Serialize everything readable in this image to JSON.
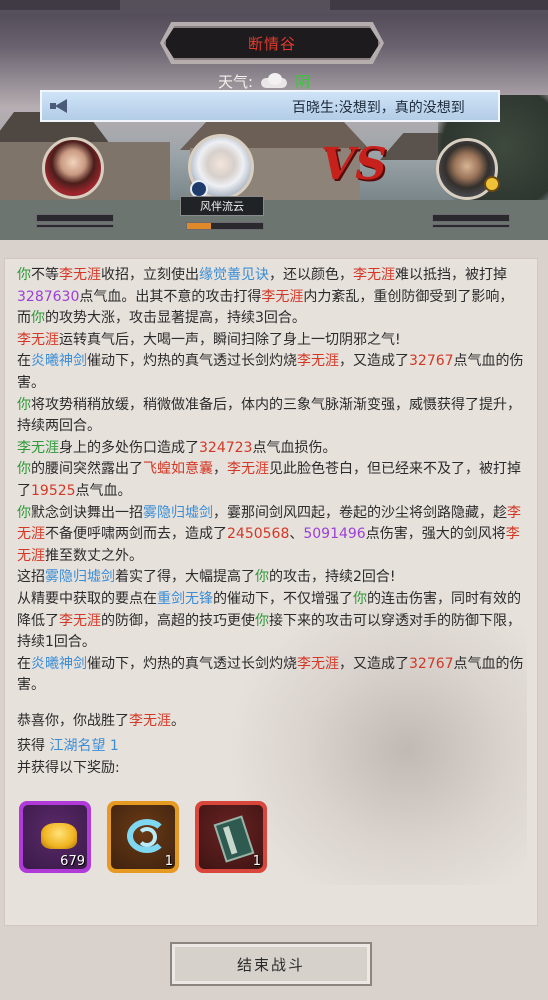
{
  "header": {
    "location": "断情谷",
    "weather_label": "天气:",
    "weather_value": "阴"
  },
  "broadcast": {
    "text": "百晓生:没想到，真的没想到"
  },
  "fighters": {
    "middle_name": "风伴流云"
  },
  "vs_text": "VS",
  "log": [
    [
      {
        "t": "你",
        "c": "g"
      },
      {
        "t": "不等"
      },
      {
        "t": "李无涯",
        "c": "r"
      },
      {
        "t": "收招，立刻使出"
      },
      {
        "t": "缘觉善见诀",
        "c": "b"
      },
      {
        "t": "，还以颜色，"
      },
      {
        "t": "李无涯",
        "c": "r"
      },
      {
        "t": "难以抵挡，被打掉"
      },
      {
        "t": "3287630",
        "c": "pu"
      },
      {
        "t": "点气血。出其不意的攻击打得"
      },
      {
        "t": "李无涯",
        "c": "r"
      },
      {
        "t": "内力紊乱，重创防御受到了影响，而"
      },
      {
        "t": "你",
        "c": "g"
      },
      {
        "t": "的攻势大涨，攻击显著提高，持续3回合。"
      }
    ],
    [
      {
        "t": "李无涯",
        "c": "r"
      },
      {
        "t": "运转真气后，大喝一声，瞬间扫除了身上一切阴邪之气!"
      }
    ],
    [
      {
        "t": "在"
      },
      {
        "t": "炎曦神剑",
        "c": "b"
      },
      {
        "t": "催动下，灼热的真气透过长剑灼烧"
      },
      {
        "t": "李无涯",
        "c": "r"
      },
      {
        "t": "，又造成了"
      },
      {
        "t": "32767",
        "c": "r"
      },
      {
        "t": "点气血的伤害。"
      }
    ],
    [
      {
        "t": "你",
        "c": "g"
      },
      {
        "t": "将攻势稍稍放缓，稍微做准备后，体内的三象气脉渐渐变强，威慑获得了提升，持续两回合。"
      }
    ],
    [
      {
        "t": "李无涯",
        "c": "g"
      },
      {
        "t": "身上的多处伤口造成了"
      },
      {
        "t": "324723",
        "c": "r"
      },
      {
        "t": "点气血损伤。"
      }
    ],
    [
      {
        "t": "你",
        "c": "g"
      },
      {
        "t": "的腰间突然露出了"
      },
      {
        "t": "飞蝗如意囊",
        "c": "r"
      },
      {
        "t": "，"
      },
      {
        "t": "李无涯",
        "c": "r"
      },
      {
        "t": "见此脸色苍白，但已经来不及了，被打掉了"
      },
      {
        "t": "19525",
        "c": "r"
      },
      {
        "t": "点气血。"
      }
    ],
    [
      {
        "t": "你",
        "c": "g"
      },
      {
        "t": "默念剑诀舞出一招"
      },
      {
        "t": "雾隐归墟剑",
        "c": "b"
      },
      {
        "t": "，霎那间剑风四起，卷起的沙尘将剑路隐藏，趁"
      },
      {
        "t": "李无涯",
        "c": "r"
      },
      {
        "t": "不备便呼啸两剑而去，造成了"
      },
      {
        "t": "2450568",
        "c": "r"
      },
      {
        "t": "、"
      },
      {
        "t": "5091496",
        "c": "pu"
      },
      {
        "t": "点伤害，强大的剑风将"
      },
      {
        "t": "李无涯",
        "c": "r"
      },
      {
        "t": "推至数丈之外。"
      }
    ],
    [
      {
        "t": "这招"
      },
      {
        "t": "雾隐归墟剑",
        "c": "b"
      },
      {
        "t": "着实了得，大幅提高了"
      },
      {
        "t": "你",
        "c": "g"
      },
      {
        "t": "的攻击，持续2回合!"
      }
    ],
    [
      {
        "t": "从精要中获取的要点在"
      },
      {
        "t": "重剑无锋",
        "c": "b"
      },
      {
        "t": "的催动下，不仅增强了"
      },
      {
        "t": "你",
        "c": "g"
      },
      {
        "t": "的连击伤害，同时有效的降低了"
      },
      {
        "t": "李无涯",
        "c": "r"
      },
      {
        "t": "的防御，高超的技巧更使"
      },
      {
        "t": "你",
        "c": "g"
      },
      {
        "t": "接下来的攻击可以穿透对手的防御下限，持续1回合。"
      }
    ],
    [
      {
        "t": "在"
      },
      {
        "t": "炎曦神剑",
        "c": "b"
      },
      {
        "t": "催动下，灼热的真气透过长剑灼烧"
      },
      {
        "t": "李无涯",
        "c": "r"
      },
      {
        "t": "，又造成了"
      },
      {
        "t": "32767",
        "c": "r"
      },
      {
        "t": "点气血的伤害。"
      }
    ]
  ],
  "result": {
    "victory": [
      {
        "t": "恭喜你，你战胜了"
      },
      {
        "t": "李无涯",
        "c": "r"
      },
      {
        "t": "。"
      }
    ],
    "gain": [
      {
        "t": "获得 "
      },
      {
        "t": "江湖名望 1",
        "c": "b"
      }
    ],
    "rewards_title": "并获得以下奖励:"
  },
  "rewards": [
    {
      "icon": "gold-ingot-icon",
      "quality": "purple",
      "qty": "679"
    },
    {
      "icon": "cyan-swirl-icon",
      "quality": "orange",
      "qty": "1"
    },
    {
      "icon": "skill-book-icon",
      "quality": "red",
      "qty": "1"
    }
  ],
  "buttons": {
    "end_battle": "结束战斗"
  },
  "colors": {
    "player": "#2f9a3a",
    "enemy": "#d33826",
    "skill": "#3b8ed6",
    "crit": "#9b3fd8"
  }
}
